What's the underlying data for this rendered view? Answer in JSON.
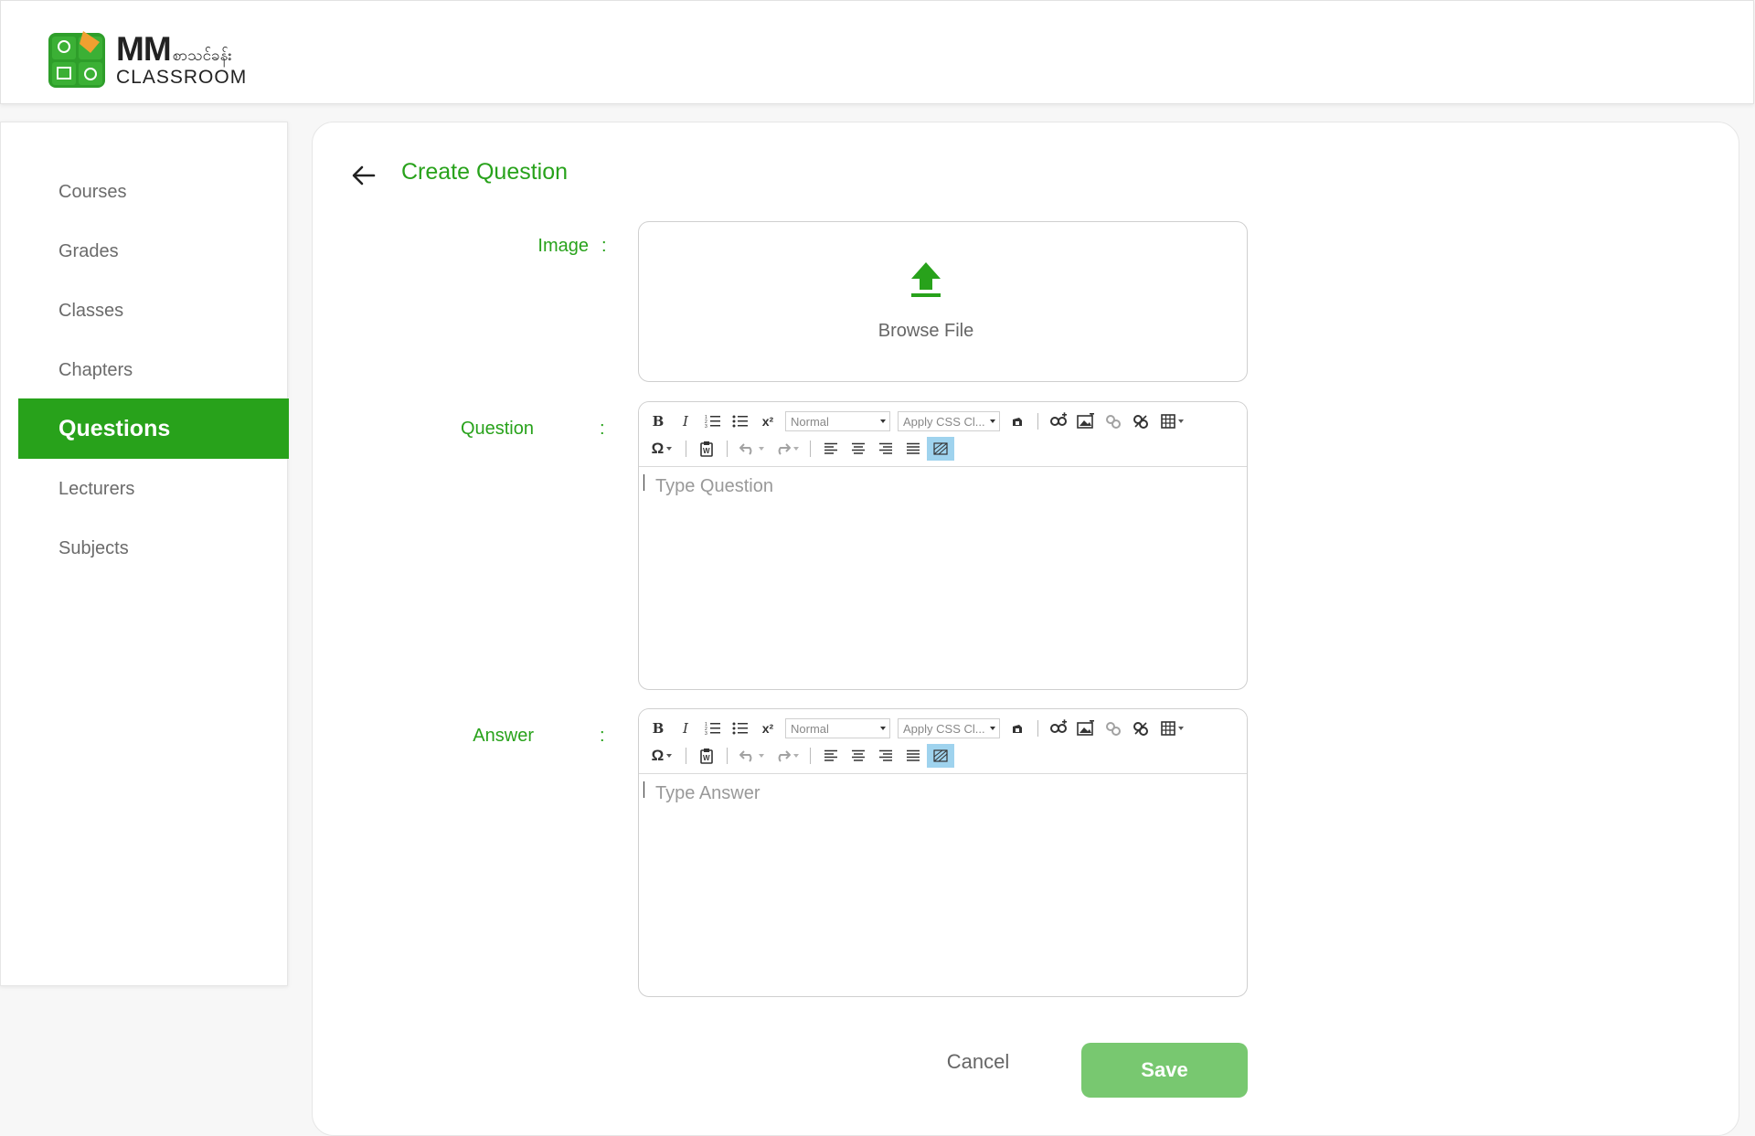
{
  "app": {
    "logo_primary": "MM",
    "logo_myanmar": "စာသင်ခန်း",
    "logo_secondary": "CLASSROOM"
  },
  "sidebar": {
    "items": [
      {
        "label": "Courses",
        "active": false
      },
      {
        "label": "Grades",
        "active": false
      },
      {
        "label": "Classes",
        "active": false
      },
      {
        "label": "Chapters",
        "active": false
      },
      {
        "label": "Questions",
        "active": true
      },
      {
        "label": "Lecturers",
        "active": false
      },
      {
        "label": "Subjects",
        "active": false
      }
    ]
  },
  "page": {
    "title": "Create Question"
  },
  "form": {
    "image_label": "Image",
    "question_label": "Question",
    "answer_label": "Answer",
    "colon": ":",
    "browse_label": "Browse File",
    "question_placeholder": "Type Question",
    "answer_placeholder": "Type Answer"
  },
  "toolbar": {
    "format_value": "Normal",
    "style_value": "Apply CSS Cl...",
    "bold": "B",
    "italic": "I",
    "superscript": "x²",
    "special_char": "Ω"
  },
  "actions": {
    "cancel_label": "Cancel",
    "save_label": "Save"
  },
  "colors": {
    "accent": "#28a21b",
    "save_button": "#78c870"
  }
}
